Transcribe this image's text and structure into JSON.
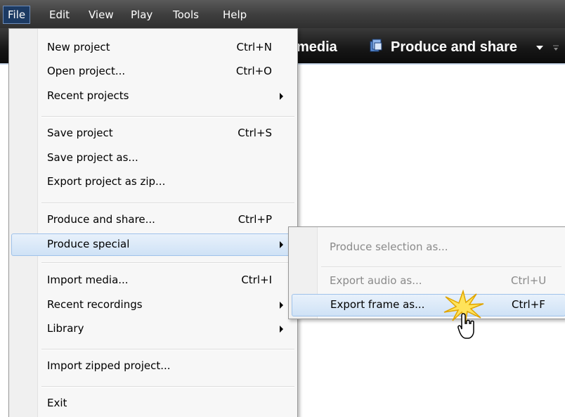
{
  "menubar": {
    "items": [
      "File",
      "Edit",
      "View",
      "Play",
      "Tools",
      "Help"
    ],
    "active": "File"
  },
  "toolbar": {
    "partial_label": "media",
    "produce_label": "Produce and share"
  },
  "file_menu": {
    "items": [
      {
        "label": "New project",
        "shortcut": "Ctrl+N"
      },
      {
        "label": "Open project...",
        "shortcut": "Ctrl+O"
      },
      {
        "label": "Recent projects",
        "shortcut": ""
      },
      {
        "label": "Save project",
        "shortcut": "Ctrl+S"
      },
      {
        "label": "Save project as...",
        "shortcut": ""
      },
      {
        "label": "Export project as zip...",
        "shortcut": ""
      },
      {
        "label": "Produce and share...",
        "shortcut": "Ctrl+P"
      },
      {
        "label": "Produce special",
        "shortcut": ""
      },
      {
        "label": "Import media...",
        "shortcut": "Ctrl+I"
      },
      {
        "label": "Recent recordings",
        "shortcut": ""
      },
      {
        "label": "Library",
        "shortcut": ""
      },
      {
        "label": "Import zipped project...",
        "shortcut": ""
      },
      {
        "label": "Exit",
        "shortcut": ""
      }
    ]
  },
  "submenu": {
    "items": [
      {
        "label": "Produce selection as...",
        "shortcut": "",
        "enabled": false
      },
      {
        "label": "Export audio as...",
        "shortcut": "Ctrl+U",
        "enabled": false
      },
      {
        "label": "Export frame as...",
        "shortcut": "Ctrl+F",
        "enabled": true
      }
    ]
  },
  "colors": {
    "highlight": "#cfe2f6",
    "highlight_border": "#9fc2ea",
    "toolbar_bg": "#161616",
    "menubar_active": "#1c3a63"
  }
}
